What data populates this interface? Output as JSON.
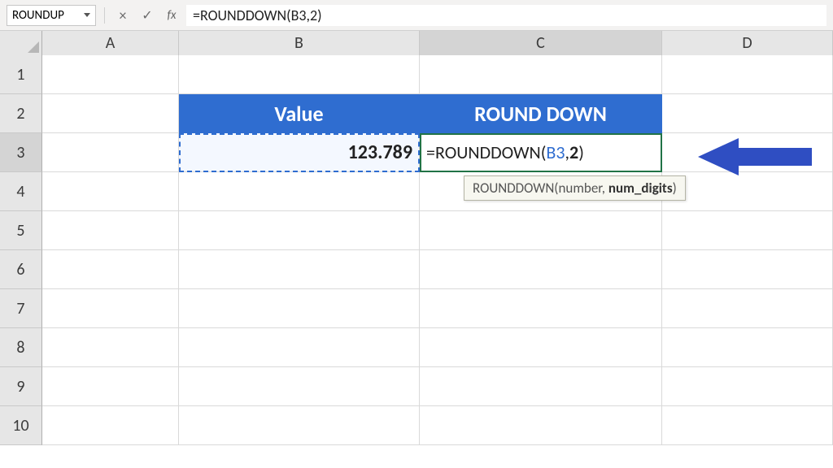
{
  "formula_bar": {
    "name_box": "ROUNDUP",
    "fx_label": "fx",
    "formula": "=ROUNDDOWN(B3,2)"
  },
  "columns": [
    "A",
    "B",
    "C",
    "D"
  ],
  "rows": [
    "1",
    "2",
    "3",
    "4",
    "5",
    "6",
    "7",
    "8",
    "9",
    "10"
  ],
  "data": {
    "B2": "Value",
    "C2": "ROUND DOWN",
    "B3": "123.789",
    "C3_prefix": "=ROUNDDOWN(",
    "C3_ref": "B3",
    "C3_comma": ",",
    "C3_arg": "2",
    "C3_suffix": ")"
  },
  "tooltip": {
    "fn": "ROUNDDOWN",
    "open": "(",
    "p1": "number",
    "sep": ", ",
    "p2": "num_digits",
    "close": ")"
  },
  "icons": {
    "cancel": "×",
    "confirm": "✓"
  }
}
